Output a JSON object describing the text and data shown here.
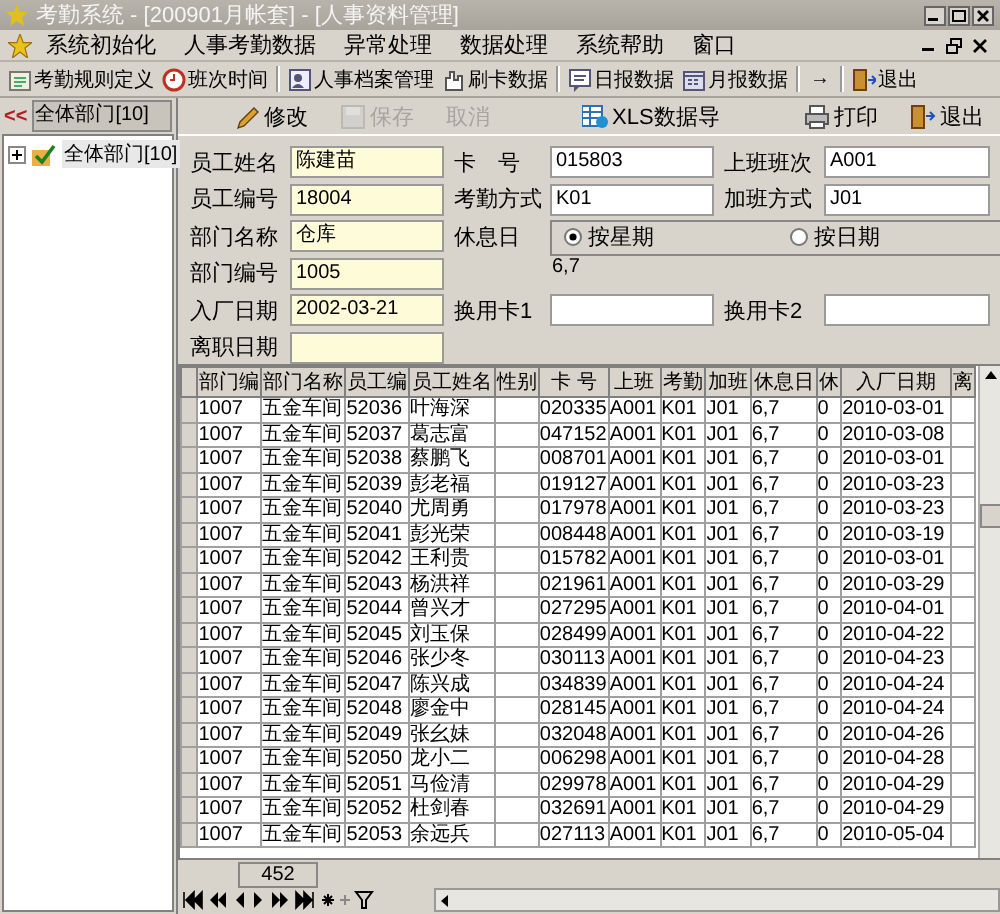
{
  "window": {
    "title": "考勤系统 - [200901月帐套] - [人事资料管理]"
  },
  "menu": [
    "系统初始化",
    "人事考勤数据",
    "异常处理",
    "数据处理",
    "系统帮助",
    "窗口"
  ],
  "toolbar": [
    {
      "kind": "button",
      "label": "考勤规则定义"
    },
    {
      "kind": "button",
      "label": "班次时间"
    },
    {
      "kind": "separator"
    },
    {
      "kind": "button",
      "label": "人事档案管理"
    },
    {
      "kind": "button",
      "label": "刷卡数据"
    },
    {
      "kind": "separator"
    },
    {
      "kind": "button",
      "label": "日报数据"
    },
    {
      "kind": "button",
      "label": "月报数据"
    },
    {
      "kind": "separator"
    },
    {
      "kind": "text",
      "label": "→"
    },
    {
      "kind": "separator"
    },
    {
      "kind": "button",
      "label": "退出"
    }
  ],
  "sidebar": {
    "collapse": "<<",
    "department": "全体部门[10]",
    "tree": [
      {
        "label": "全体部门[10]",
        "expanded": false
      }
    ]
  },
  "actions": [
    {
      "label": "修改",
      "disabled": false
    },
    {
      "label": "保存",
      "disabled": true
    },
    {
      "label": "取消",
      "disabled": true
    },
    {
      "label": "XLS数据导",
      "disabled": false
    },
    {
      "label": "打印",
      "disabled": false
    },
    {
      "label": "退出",
      "disabled": false
    }
  ],
  "form": {
    "rows": [
      [
        {
          "kind": "field",
          "label": "员工姓名",
          "value": "陈建苗",
          "highlighted": true
        },
        {
          "kind": "field",
          "label": "卡　号",
          "value": "015803",
          "highlighted": false
        },
        {
          "kind": "field",
          "label": "上班班次",
          "value": "A001",
          "highlighted": false
        }
      ],
      [
        {
          "kind": "field",
          "label": "员工编号",
          "value": "18004",
          "highlighted": true
        },
        {
          "kind": "field",
          "label": "考勤方式",
          "value": "K01",
          "highlighted": false
        },
        {
          "kind": "field",
          "label": "加班方式",
          "value": "J01",
          "highlighted": false
        }
      ],
      [
        {
          "kind": "field",
          "label": "部门名称",
          "value": "仓库",
          "highlighted": true
        },
        {
          "kind": "restday",
          "label": "休息日",
          "options": [
            {
              "label": "按星期",
              "selected": true
            },
            {
              "label": "按日期",
              "selected": false
            }
          ],
          "value": "6,7"
        }
      ],
      [
        {
          "kind": "field",
          "label": "部门编号",
          "value": "1005",
          "highlighted": true
        }
      ],
      [
        {
          "kind": "field",
          "label": "入厂日期",
          "value": "2002-03-21",
          "highlighted": true
        },
        {
          "kind": "field",
          "label": "换用卡1",
          "highlighted": false
        },
        {
          "kind": "field",
          "label": "换用卡2",
          "highlighted": false
        }
      ],
      [
        {
          "kind": "field",
          "label": "离职日期",
          "highlighted": true
        }
      ]
    ]
  },
  "table": {
    "columns": [
      "部门编",
      "部门名称",
      "员工编",
      "员工姓名",
      "性别",
      "卡 号",
      "上班",
      "考勤",
      "加班",
      "休息日",
      "休",
      "入厂日期",
      "离"
    ],
    "rows": [
      [
        "1007",
        "五金车间",
        "52036",
        "叶海深",
        "",
        "020335",
        "A001",
        "K01",
        "J01",
        "6,7",
        "0",
        "2010-03-01",
        ""
      ],
      [
        "1007",
        "五金车间",
        "52037",
        "葛志富",
        "",
        "047152",
        "A001",
        "K01",
        "J01",
        "6,7",
        "0",
        "2010-03-08",
        ""
      ],
      [
        "1007",
        "五金车间",
        "52038",
        "蔡鹏飞",
        "",
        "008701",
        "A001",
        "K01",
        "J01",
        "6,7",
        "0",
        "2010-03-01",
        ""
      ],
      [
        "1007",
        "五金车间",
        "52039",
        "彭老福",
        "",
        "019127",
        "A001",
        "K01",
        "J01",
        "6,7",
        "0",
        "2010-03-23",
        ""
      ],
      [
        "1007",
        "五金车间",
        "52040",
        "尤周勇",
        "",
        "017978",
        "A001",
        "K01",
        "J01",
        "6,7",
        "0",
        "2010-03-23",
        ""
      ],
      [
        "1007",
        "五金车间",
        "52041",
        "彭光荣",
        "",
        "008448",
        "A001",
        "K01",
        "J01",
        "6,7",
        "0",
        "2010-03-19",
        ""
      ],
      [
        "1007",
        "五金车间",
        "52042",
        "王利贵",
        "",
        "015782",
        "A001",
        "K01",
        "J01",
        "6,7",
        "0",
        "2010-03-01",
        ""
      ],
      [
        "1007",
        "五金车间",
        "52043",
        "杨洪祥",
        "",
        "021961",
        "A001",
        "K01",
        "J01",
        "6,7",
        "0",
        "2010-03-29",
        ""
      ],
      [
        "1007",
        "五金车间",
        "52044",
        "曾兴才",
        "",
        "027295",
        "A001",
        "K01",
        "J01",
        "6,7",
        "0",
        "2010-04-01",
        ""
      ],
      [
        "1007",
        "五金车间",
        "52045",
        "刘玉保",
        "",
        "028499",
        "A001",
        "K01",
        "J01",
        "6,7",
        "0",
        "2010-04-22",
        ""
      ],
      [
        "1007",
        "五金车间",
        "52046",
        "张少冬",
        "",
        "030113",
        "A001",
        "K01",
        "J01",
        "6,7",
        "0",
        "2010-04-23",
        ""
      ],
      [
        "1007",
        "五金车间",
        "52047",
        "陈兴成",
        "",
        "034839",
        "A001",
        "K01",
        "J01",
        "6,7",
        "0",
        "2010-04-24",
        ""
      ],
      [
        "1007",
        "五金车间",
        "52048",
        "廖金中",
        "",
        "028145",
        "A001",
        "K01",
        "J01",
        "6,7",
        "0",
        "2010-04-24",
        ""
      ],
      [
        "1007",
        "五金车间",
        "52049",
        "张幺妹",
        "",
        "032048",
        "A001",
        "K01",
        "J01",
        "6,7",
        "0",
        "2010-04-26",
        ""
      ],
      [
        "1007",
        "五金车间",
        "52050",
        "龙小二",
        "",
        "006298",
        "A001",
        "K01",
        "J01",
        "6,7",
        "0",
        "2010-04-28",
        ""
      ],
      [
        "1007",
        "五金车间",
        "52051",
        "马俭清",
        "",
        "029978",
        "A001",
        "K01",
        "J01",
        "6,7",
        "0",
        "2010-04-29",
        ""
      ],
      [
        "1007",
        "五金车间",
        "52052",
        "杜剑春",
        "",
        "032691",
        "A001",
        "K01",
        "J01",
        "6,7",
        "0",
        "2010-04-29",
        ""
      ],
      [
        "1007",
        "五金车间",
        "52053",
        "余远兵",
        "",
        "027113",
        "A001",
        "K01",
        "J01",
        "6,7",
        "0",
        "2010-05-04",
        ""
      ]
    ],
    "record_count": "452"
  }
}
